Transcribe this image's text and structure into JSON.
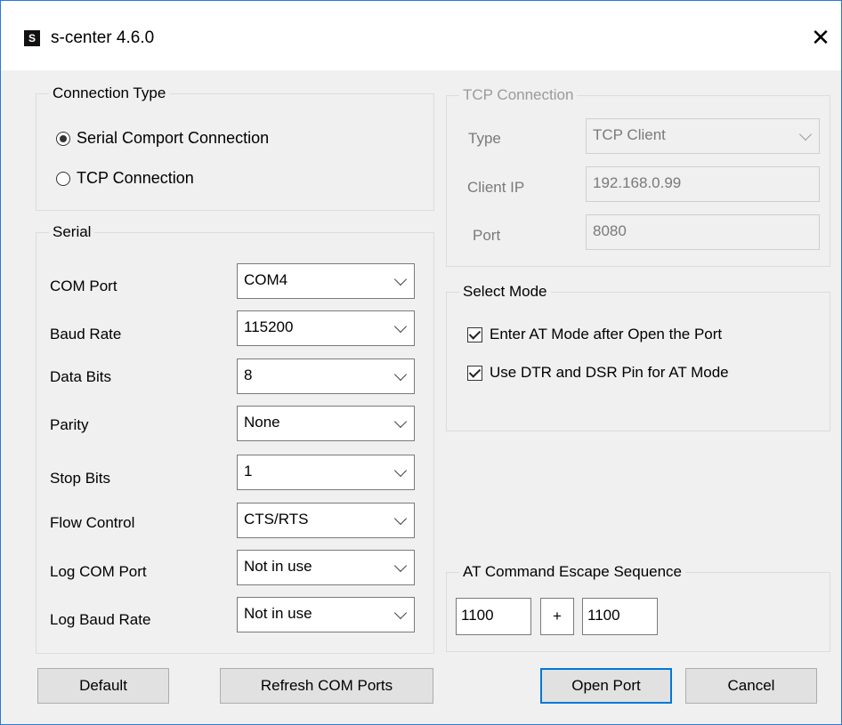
{
  "window": {
    "title": "s-center 4.6.0",
    "app_icon_letter": "S",
    "close_glyph": "✕"
  },
  "connection_type": {
    "legend": "Connection Type",
    "options": [
      {
        "label": "Serial Comport Connection",
        "selected": true
      },
      {
        "label": "TCP Connection",
        "selected": false
      }
    ]
  },
  "serial": {
    "legend": "Serial",
    "fields": [
      {
        "label": "COM Port",
        "value": "COM4"
      },
      {
        "label": "Baud Rate",
        "value": "115200"
      },
      {
        "label": "Data Bits",
        "value": "8"
      },
      {
        "label": "Parity",
        "value": "None"
      },
      {
        "label": "Stop Bits",
        "value": "1"
      },
      {
        "label": "Flow Control",
        "value": "CTS/RTS"
      },
      {
        "label": "Log COM Port",
        "value": "Not in use"
      },
      {
        "label": "Log Baud Rate",
        "value": "Not in use"
      }
    ]
  },
  "tcp": {
    "legend": "TCP Connection",
    "type_label": "Type",
    "type_value": "TCP Client",
    "ip_label": "Client IP",
    "ip_value": "192.168.0.99",
    "port_label": "Port",
    "port_value": "8080"
  },
  "select_mode": {
    "legend": "Select Mode",
    "options": [
      {
        "label": "Enter AT Mode after Open the Port",
        "checked": true
      },
      {
        "label": "Use DTR and DSR Pin for AT Mode",
        "checked": true
      }
    ]
  },
  "escape": {
    "legend": "AT Command Escape Sequence",
    "first": "1100",
    "plus": "+",
    "second": "1100"
  },
  "buttons": {
    "default": "Default",
    "refresh": "Refresh COM Ports",
    "open": "Open Port",
    "cancel": "Cancel"
  },
  "colors": {
    "accent": "#0078d7",
    "window_border": "#2b79d6",
    "background": "#f0f0f0"
  }
}
